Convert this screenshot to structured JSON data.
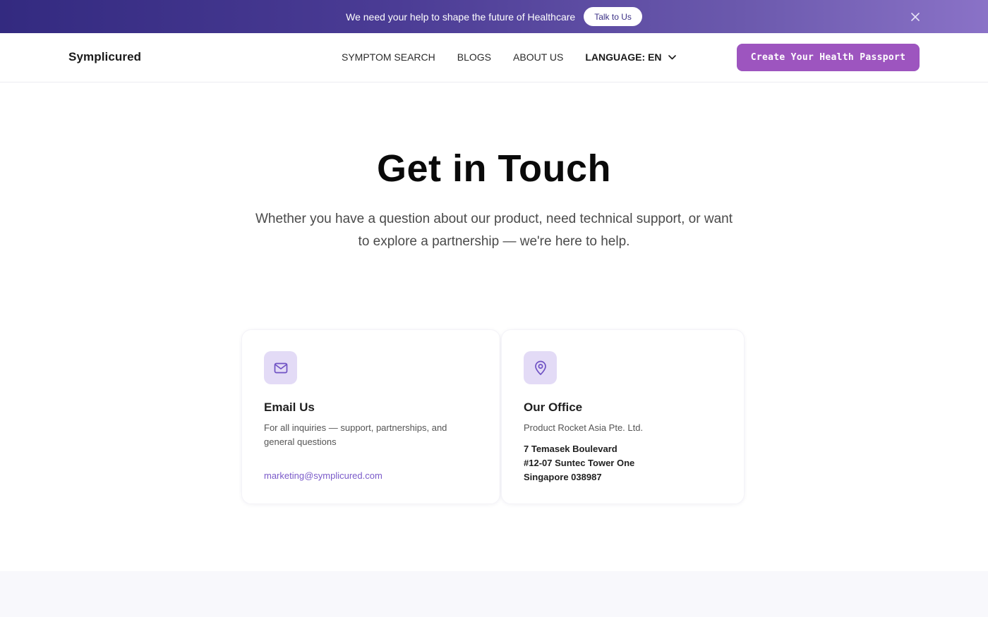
{
  "announcement": {
    "text": "We need your help to shape the future of Healthcare",
    "button_label": "Talk to Us",
    "close_icon": "close-icon"
  },
  "nav": {
    "logo": "Symplicured",
    "links": [
      "SYMPTOM SEARCH",
      "BLOGS",
      "ABOUT US"
    ],
    "language_label": "LANGUAGE: EN",
    "language_icon": "chevron-down-icon",
    "cta_label": "Create Your Health Passport"
  },
  "hero": {
    "title": "Get in Touch",
    "subtitle": "Whether you have a question about our product, need technical support, or want to explore a partnership — we're here to help."
  },
  "cards": {
    "email": {
      "icon": "mail-icon",
      "title": "Email Us",
      "description": "For all inquiries — support, partnerships, and general questions",
      "link": "marketing@symplicured.com"
    },
    "office": {
      "icon": "map-pin-icon",
      "title": "Our Office",
      "company": "Product Rocket Asia Pte. Ltd.",
      "address_lines": [
        "7 Temasek Boulevard",
        "#12-07 Suntec Tower One",
        "Singapore 038987"
      ]
    }
  },
  "colors": {
    "announcement_gradient_start": "#332a80",
    "announcement_gradient_end": "#8a72c7",
    "cta_background": "#9d55bf",
    "icon_tile_background": "#e3dbf6",
    "icon_stroke": "#6f52c4",
    "link_color": "#7a5ac9",
    "footer_band": "#f8f8fc"
  }
}
